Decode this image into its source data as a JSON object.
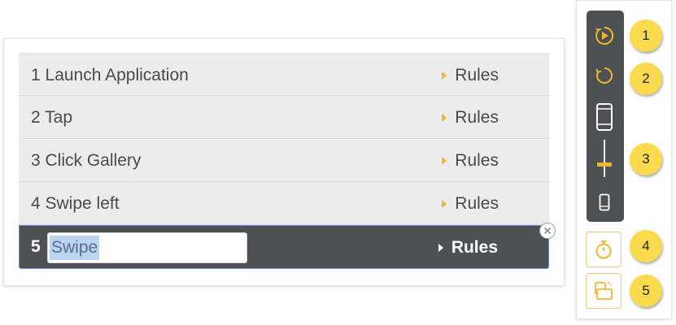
{
  "steps": [
    {
      "label": "1 Launch Application",
      "rules": "Rules"
    },
    {
      "label": "2 Tap",
      "rules": "Rules"
    },
    {
      "label": "3 Click Gallery",
      "rules": "Rules"
    },
    {
      "label": "4 Swipe left",
      "rules": "Rules"
    }
  ],
  "active_step": {
    "number": "5",
    "input_value": "Swipe",
    "rules": "Rules"
  },
  "toolbar": {
    "icons": [
      "play-circle-icon",
      "refresh-icon",
      "phone-large-icon",
      "zoom-slider",
      "phone-small-icon",
      "timer-icon",
      "rotate-screen-icon"
    ]
  },
  "callouts": [
    "1",
    "2",
    "3",
    "4",
    "5"
  ],
  "colors": {
    "accent": "#f2b531",
    "dark_panel": "#4e5153",
    "callout": "#f9db4d",
    "selection": "#b9d3f1"
  }
}
